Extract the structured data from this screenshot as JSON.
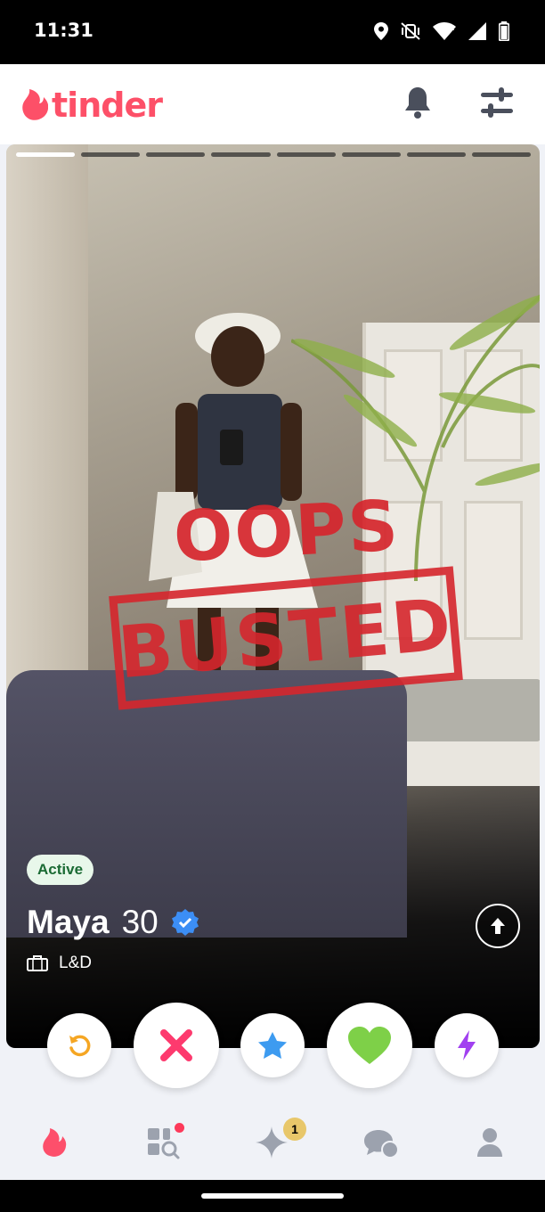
{
  "status_bar": {
    "time": "11:31",
    "icons": [
      "location-icon",
      "vibrate-off-icon",
      "wifi-icon",
      "signal-icon",
      "battery-icon"
    ]
  },
  "header": {
    "logo_text": "tinder",
    "brand_color": "#fd5068",
    "icons": [
      "notifications-bell-icon",
      "filter-sliders-icon"
    ]
  },
  "card": {
    "photo_index": 1,
    "photo_count": 8,
    "stamp_top": "OOPS",
    "stamp_bottom": "BUSTED",
    "active_label": "Active",
    "name": "Maya",
    "age": "30",
    "job": "L&D"
  },
  "actions": [
    "rewind-icon",
    "nope-icon",
    "super-like-icon",
    "like-icon",
    "boost-icon"
  ],
  "bottom_nav": {
    "items": [
      "home-flame-icon",
      "explore-icon",
      "gold-sparkle-icon",
      "messages-icon",
      "profile-icon"
    ],
    "gold_badge": "1"
  }
}
